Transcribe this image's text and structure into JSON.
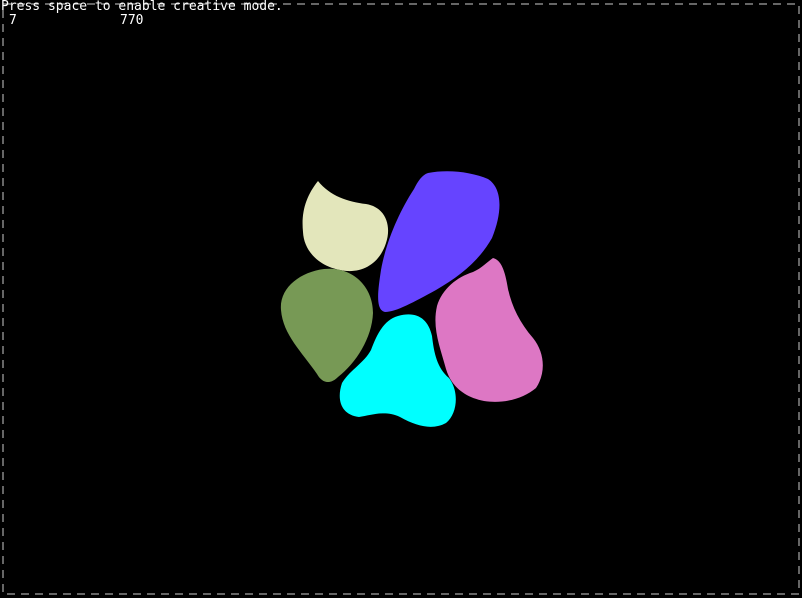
{
  "hud": {
    "instruction": "Press space to enable creative mode.",
    "level": "7",
    "score": "770"
  },
  "colors": {
    "background": "#000000",
    "border": "#cccccc",
    "hud_text": "#ffffff"
  },
  "blobs": [
    {
      "name": "cream-blob",
      "color": "#e3e6bb"
    },
    {
      "name": "violet-blob",
      "color": "#6644ff"
    },
    {
      "name": "olive-blob",
      "color": "#779955"
    },
    {
      "name": "cyan-blob",
      "color": "#00ffff"
    },
    {
      "name": "pink-blob",
      "color": "#dd77c4"
    }
  ]
}
